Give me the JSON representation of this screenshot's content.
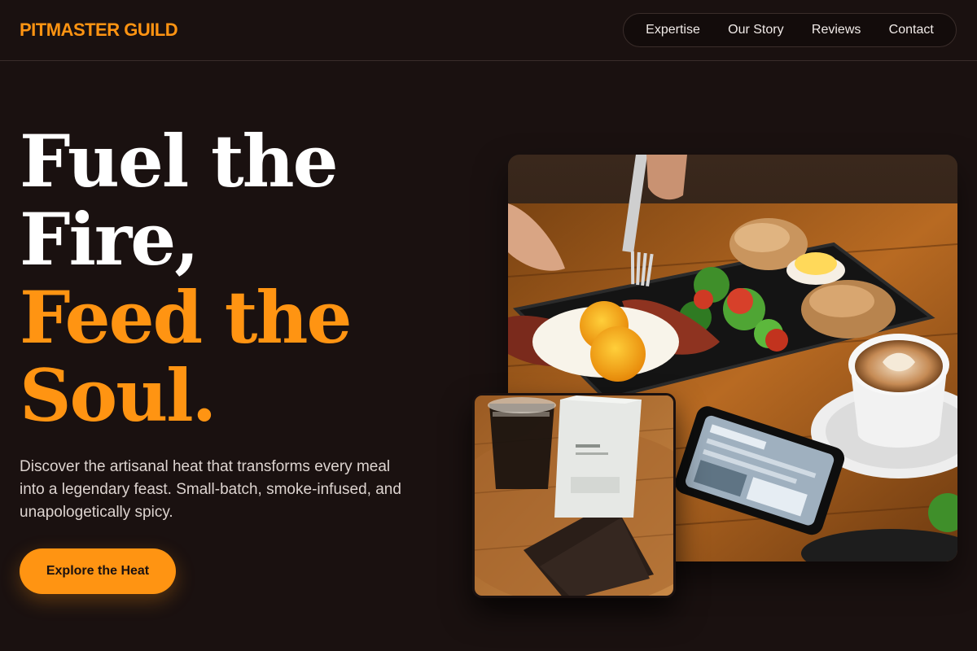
{
  "header": {
    "logo": "PITMASTER GUILD",
    "nav": [
      {
        "label": "Expertise"
      },
      {
        "label": "Our Story"
      },
      {
        "label": "Reviews"
      },
      {
        "label": "Contact"
      }
    ]
  },
  "hero": {
    "title_line1": "Fuel the",
    "title_line2": "Fire,",
    "title_line3": "Feed the",
    "title_line4": "Soul.",
    "description": "Discover the artisanal heat that transforms every meal into a legendary feast. Small-batch, smoke-infused, and unapologetically spicy.",
    "cta_label": "Explore the Heat"
  },
  "images": {
    "main_alt": "breakfast-plate-with-coffee",
    "small_alt": "iced-coffee-with-bag"
  },
  "colors": {
    "background": "#1a1110",
    "accent": "#ff9412",
    "text": "#ffffff"
  }
}
